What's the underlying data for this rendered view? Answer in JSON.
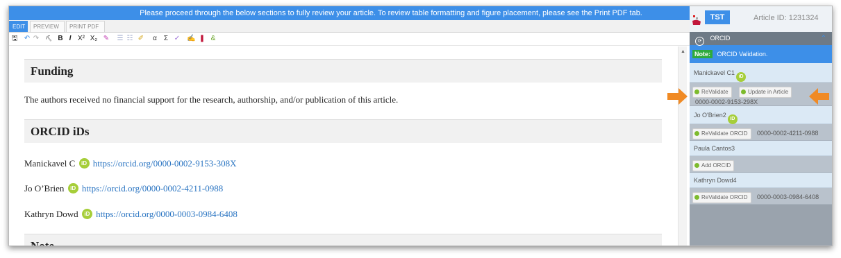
{
  "banner": {
    "text": "Please proceed through the below sections to fully review your article. To review table formatting and figure placement, please see the Print PDF tab."
  },
  "tabs": [
    {
      "label": "EDIT",
      "active": true
    },
    {
      "label": "PREVIEW",
      "active": false
    },
    {
      "label": "PRINT PDF",
      "active": false
    }
  ],
  "toolbar": {
    "icons": [
      "save-icon",
      "undo-icon",
      "redo-icon",
      "find-icon",
      "bold-icon",
      "italic-icon",
      "superscript-icon",
      "subscript-icon",
      "clear-format-icon",
      "numbered-list-icon",
      "bullet-list-icon",
      "highlight-icon",
      "greek-alpha-icon",
      "sigma-icon",
      "spellcheck-icon",
      "track-changes-icon",
      "book-icon",
      "special-chars-icon"
    ],
    "glyphs": {
      "save": "🖫",
      "undo": "↶",
      "redo": "↷",
      "find": "⛏",
      "bold": "B",
      "italic": "I",
      "superscript": "X²",
      "subscript": "X₂",
      "clear": "✎",
      "olist": "☰",
      "ulist": "☷",
      "highlight": "✐",
      "alpha": "α",
      "sigma": "Σ",
      "spell": "✓",
      "track": "✍",
      "book": "❚",
      "chars": "&"
    }
  },
  "content": {
    "funding_heading": "Funding",
    "funding_text": "The authors received no financial support for the research, authorship, and/or publication of this article.",
    "orcid_heading": "ORCID iDs",
    "orcid_entries": [
      {
        "name": "Manickavel C",
        "url": "https://orcid.org/0000-0002-9153-308X"
      },
      {
        "name": "Jo O’Brien",
        "url": "https://orcid.org/0000-0002-4211-0988"
      },
      {
        "name": "Kathryn Dowd",
        "url": "https://orcid.org/0000-0003-0984-6408"
      }
    ],
    "note_heading": "Note",
    "orcid_badge": "iD"
  },
  "panel": {
    "tst_label": "TST",
    "article_id": "Article ID: 1231324",
    "section_label": "ORCID",
    "note_tag": "Note:",
    "note_text": "ORCID Validation.",
    "authors": [
      {
        "name": "Manickavel C1",
        "has_badge": true
      },
      {
        "name": "Jo O'Brien2",
        "has_badge": true
      },
      {
        "name": "Paula Cantos3",
        "has_badge": false
      },
      {
        "name": "Kathryn Dowd4",
        "has_badge": false
      }
    ],
    "actions": {
      "revalidate": "ReValidate",
      "update_in_article": "Update in Article",
      "author1_id": "0000-0002-9153-298X",
      "revalidate_orcid": "ReValidate ORCID",
      "author2_id": "0000-0002-4211-0988",
      "add_orcid": "Add ORCID",
      "author4_id": "0000-0003-0984-6408"
    },
    "arrow_color": "#f08a24"
  }
}
